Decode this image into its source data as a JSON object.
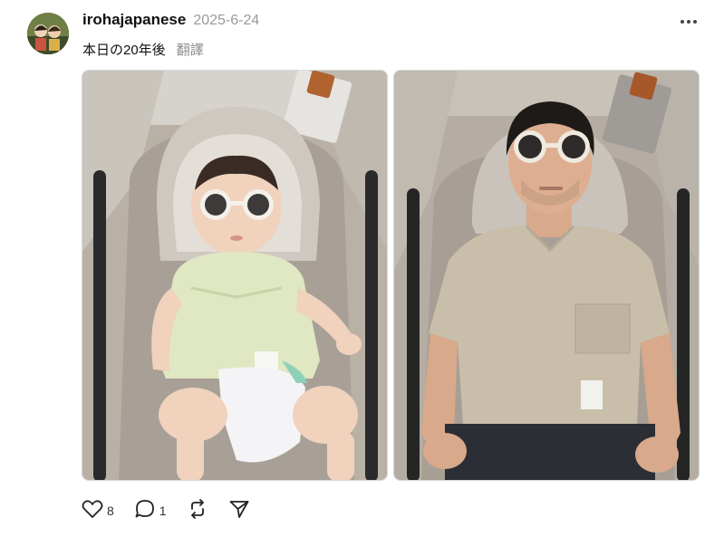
{
  "post": {
    "username": "irohajapanese",
    "date": "2025-6-24",
    "caption": "本日の20年後",
    "translate_label": "翻譯"
  },
  "photos": [
    {
      "subject": "baby-in-stroller-with-sunglasses"
    },
    {
      "subject": "adult-man-in-stroller-with-sunglasses"
    }
  ],
  "actions": {
    "like_count": "8",
    "reply_count": "1",
    "repost_icon": "repost-icon",
    "share_icon": "share-icon"
  },
  "colors": {
    "text": "#111111",
    "muted": "#9a9a9a"
  }
}
